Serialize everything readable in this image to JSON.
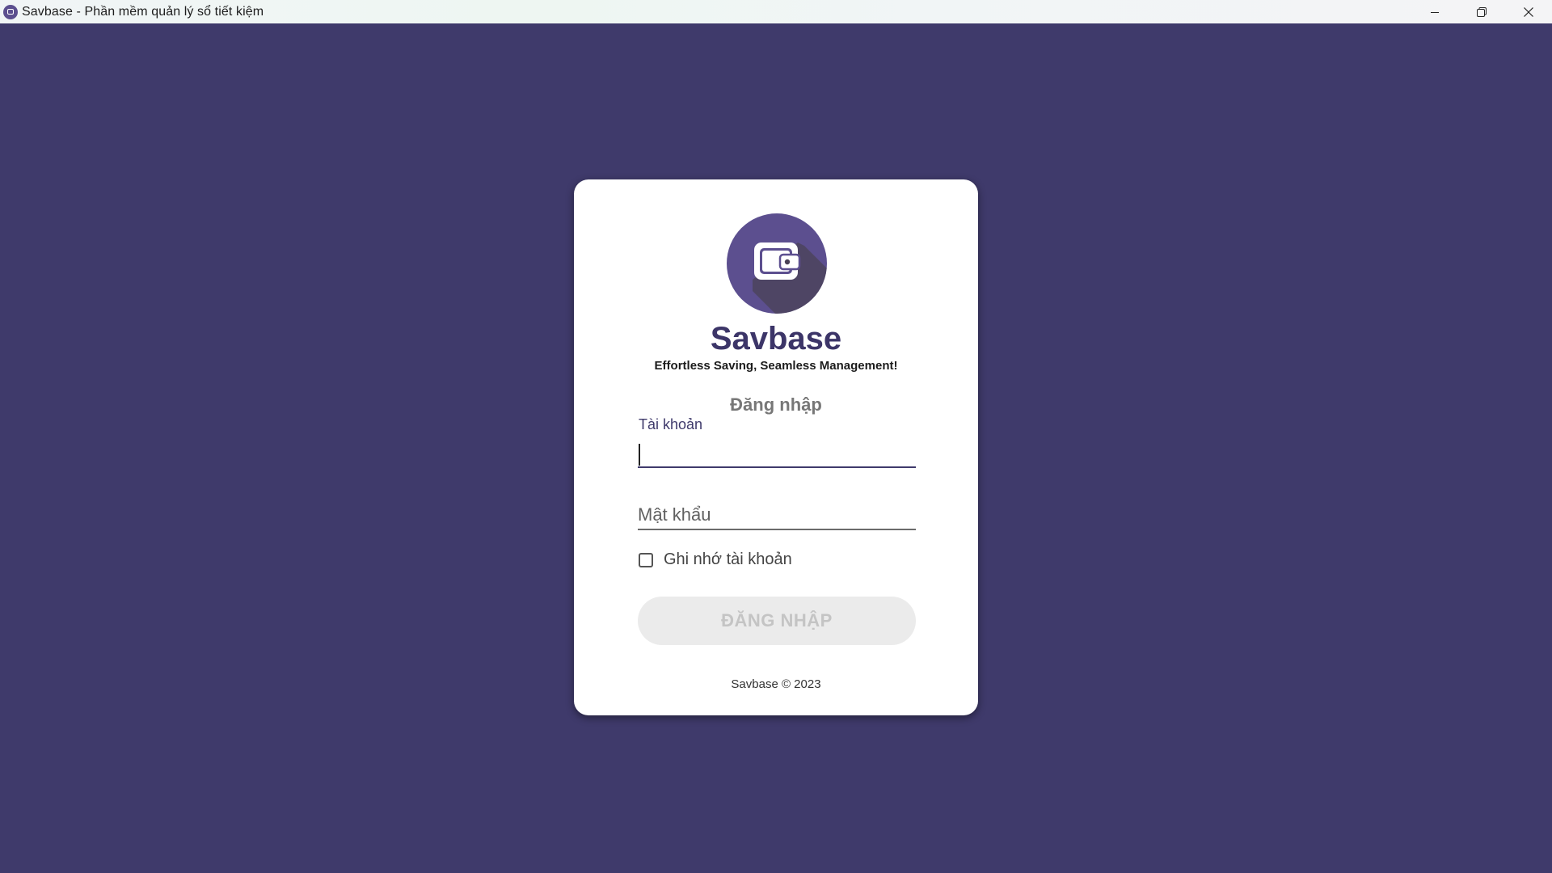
{
  "window": {
    "title": "Savbase - Phần mềm quản lý sổ tiết kiệm",
    "controls": [
      "minimize-icon",
      "restore-icon",
      "close-icon"
    ]
  },
  "colors": {
    "background": "#3f3a6b",
    "brand": "#3c3568",
    "logo_circle": "#5c4f8f",
    "card": "#ffffff",
    "button_disabled_bg": "#ebebeb",
    "button_disabled_text": "#c4c4c4"
  },
  "brand": {
    "name": "Savbase",
    "tagline": "Effortless Saving, Seamless Management!",
    "logo_icon": "wallet-icon"
  },
  "login": {
    "heading": "Đăng nhập",
    "username": {
      "label": "Tài khoản",
      "value": ""
    },
    "password": {
      "placeholder": "Mật khẩu",
      "value": ""
    },
    "remember": {
      "label": "Ghi nhớ tài khoản",
      "checked": false
    },
    "submit_label": "ĐĂNG NHẬP",
    "submit_enabled": false
  },
  "footer": {
    "text": "Savbase © 2023"
  }
}
